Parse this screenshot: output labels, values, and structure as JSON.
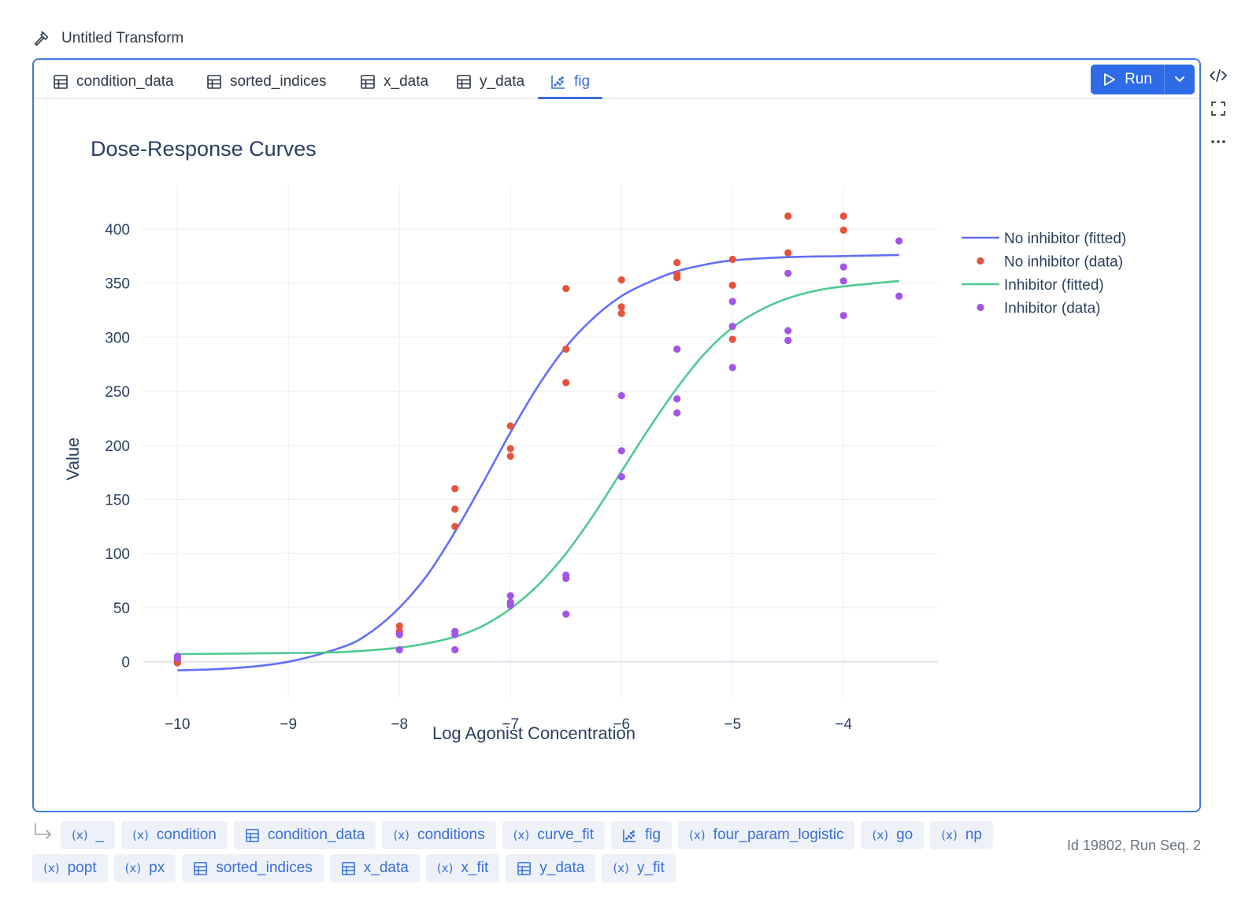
{
  "header": {
    "title": "Untitled Transform"
  },
  "tabs": [
    {
      "label": "condition_data",
      "icon": "table-icon",
      "active": false
    },
    {
      "label": "sorted_indices",
      "icon": "table-icon",
      "active": false
    },
    {
      "label": "x_data",
      "icon": "table-icon",
      "active": false
    },
    {
      "label": "y_data",
      "icon": "table-icon",
      "active": false
    },
    {
      "label": "fig",
      "icon": "chart-icon",
      "active": true
    }
  ],
  "toolbar": {
    "run_label": "Run"
  },
  "side_icons": [
    "code-icon",
    "expand-icon",
    "more-icon"
  ],
  "variables": {
    "row1": [
      {
        "label": "_",
        "icon": "variable-icon"
      },
      {
        "label": "condition",
        "icon": "variable-icon"
      },
      {
        "label": "condition_data",
        "icon": "table-icon"
      },
      {
        "label": "conditions",
        "icon": "variable-icon"
      },
      {
        "label": "curve_fit",
        "icon": "variable-icon"
      },
      {
        "label": "fig",
        "icon": "chart-icon"
      },
      {
        "label": "four_param_logistic",
        "icon": "variable-icon"
      },
      {
        "label": "go",
        "icon": "variable-icon"
      },
      {
        "label": "np",
        "icon": "variable-icon"
      }
    ],
    "row2": [
      {
        "label": "popt",
        "icon": "variable-icon"
      },
      {
        "label": "px",
        "icon": "variable-icon"
      },
      {
        "label": "sorted_indices",
        "icon": "table-icon"
      },
      {
        "label": "x_data",
        "icon": "table-icon"
      },
      {
        "label": "x_fit",
        "icon": "variable-icon"
      },
      {
        "label": "y_data",
        "icon": "table-icon"
      },
      {
        "label": "y_fit",
        "icon": "variable-icon"
      }
    ]
  },
  "footer": {
    "meta": "Id 19802,  Run Seq. 2"
  },
  "colors": {
    "accent": "#2e6be6",
    "no_inhibitor": "#636efa",
    "no_inhibitor_data": "#e5533b",
    "inhibitor": "#4fc993",
    "inhibitor_data": "#a155e8"
  },
  "chart_data": {
    "type": "scatter",
    "title": "Dose-Response Curves",
    "xlabel": "Log Agonist Concentration",
    "ylabel": "Value",
    "xlim": [
      -10.3,
      -3.15
    ],
    "ylim": [
      -33,
      440
    ],
    "x_ticks": [
      -10,
      -9,
      -8,
      -7,
      -6,
      -5,
      -4
    ],
    "x_tick_labels": [
      "−10",
      "−9",
      "−8",
      "−7",
      "−6",
      "−5",
      "−4"
    ],
    "y_ticks": [
      0,
      50,
      100,
      150,
      200,
      250,
      300,
      350,
      400
    ],
    "y_tick_labels": [
      "0",
      "50",
      "100",
      "150",
      "200",
      "250",
      "300",
      "350",
      "400"
    ],
    "grid": true,
    "legend_position": "top-right",
    "series": [
      {
        "name": "No inhibitor (fitted)",
        "mode": "line",
        "color": "#636efa",
        "x": [
          -10,
          -9.5,
          -9,
          -8.5,
          -8.25,
          -8,
          -7.75,
          -7.5,
          -7.25,
          -7,
          -6.75,
          -6.5,
          -6.25,
          -6,
          -5.75,
          -5.5,
          -5.25,
          -5,
          -4.5,
          -4,
          -3.5
        ],
        "y": [
          -8,
          -6,
          0,
          14,
          28,
          50,
          80,
          120,
          165,
          212,
          255,
          291,
          318,
          338,
          351,
          361,
          367,
          371,
          374,
          375,
          376
        ]
      },
      {
        "name": "No inhibitor (data)",
        "mode": "markers",
        "color": "#e5533b",
        "x": [
          -10,
          -10,
          -10,
          -8,
          -8,
          -8,
          -7.5,
          -7.5,
          -7.5,
          -7,
          -7,
          -7,
          -6.5,
          -6.5,
          -6.5,
          -6,
          -6,
          -6,
          -5.5,
          -5.5,
          -5.5,
          -5,
          -5,
          -5,
          -4.5,
          -4.5,
          -4,
          -4
        ],
        "y": [
          3,
          1,
          -1,
          33,
          28,
          26,
          160,
          141,
          125,
          218,
          197,
          190,
          345,
          289,
          258,
          353,
          328,
          322,
          369,
          358,
          355,
          372,
          348,
          298,
          412,
          378,
          412,
          399
        ]
      },
      {
        "name": "Inhibitor (fitted)",
        "mode": "line",
        "color": "#4fc993",
        "x": [
          -10,
          -9,
          -8.5,
          -8,
          -7.75,
          -7.5,
          -7.25,
          -7,
          -6.75,
          -6.5,
          -6.25,
          -6,
          -5.75,
          -5.5,
          -5.25,
          -5,
          -4.75,
          -4.5,
          -4.25,
          -4,
          -3.5
        ],
        "y": [
          7,
          8,
          9,
          13,
          17,
          23,
          33,
          49,
          71,
          100,
          136,
          176,
          216,
          253,
          285,
          309,
          325,
          336,
          343,
          347,
          352
        ]
      },
      {
        "name": "Inhibitor (data)",
        "mode": "markers",
        "color": "#a155e8",
        "x": [
          -10,
          -10,
          -8,
          -8,
          -7.5,
          -7.5,
          -7.5,
          -7,
          -7,
          -7,
          -6.5,
          -6.5,
          -6.5,
          -6,
          -6,
          -6,
          -5.5,
          -5.5,
          -5.5,
          -5,
          -5,
          -5,
          -4.5,
          -4.5,
          -4.5,
          -4,
          -4,
          -4,
          -3.5,
          -3.5
        ],
        "y": [
          5,
          3,
          25,
          11,
          28,
          25,
          11,
          61,
          55,
          52,
          80,
          77,
          44,
          246,
          195,
          171,
          289,
          243,
          230,
          333,
          310,
          272,
          359,
          306,
          297,
          365,
          352,
          320,
          389,
          338
        ]
      }
    ]
  }
}
